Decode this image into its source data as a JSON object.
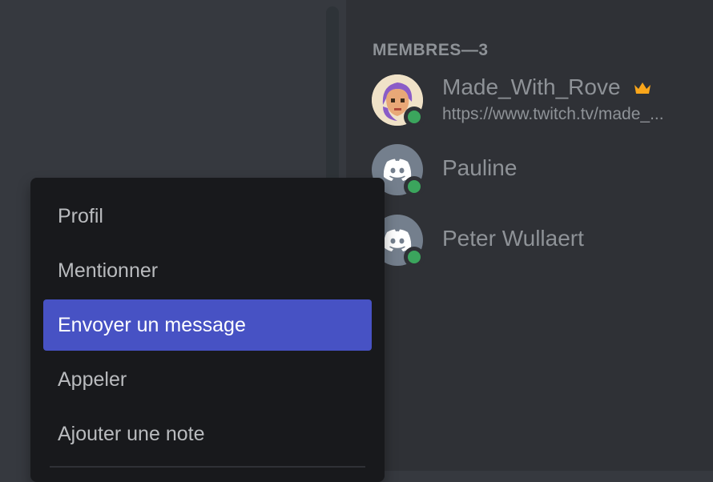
{
  "members": {
    "header": "MEMBRES—3",
    "list": [
      {
        "name": "Made_With_Rove",
        "activity": "https://www.twitch.tv/made_...",
        "owner": true,
        "status": "online"
      },
      {
        "name": "Pauline",
        "status": "online"
      },
      {
        "name": "Peter Wullaert",
        "status": "online"
      }
    ]
  },
  "context_menu": {
    "items": [
      {
        "label": "Profil"
      },
      {
        "label": "Mentionner"
      },
      {
        "label": "Envoyer un message",
        "highlighted": true
      },
      {
        "label": "Appeler"
      },
      {
        "label": "Ajouter une note"
      }
    ]
  },
  "colors": {
    "background": "#36393f",
    "sidebar": "#2f3136",
    "menu": "#18191c",
    "highlight": "#4752c4",
    "online": "#3ba55d",
    "crown": "#faa61a"
  }
}
